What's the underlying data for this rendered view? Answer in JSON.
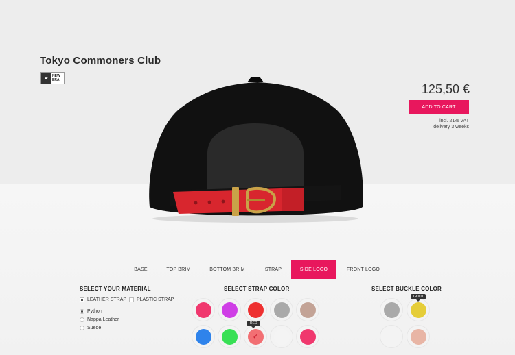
{
  "product": {
    "title": "Tokyo Commoners Club",
    "brand_logo_text": "NEW ERA",
    "price": "125,50 €",
    "add_to_cart": "ADD TO CART",
    "vat_line": "incl. 21% VAT",
    "delivery_line": "delivery 3 weeks"
  },
  "tabs": [
    {
      "label": "BASE",
      "active": false
    },
    {
      "label": "TOP BRIM",
      "active": false
    },
    {
      "label": "BOTTOM BRIM",
      "active": false
    },
    {
      "label": "STRAP",
      "active": false
    },
    {
      "label": "SIDE LOGO",
      "active": true
    },
    {
      "label": "FRONT LOGO",
      "active": false
    }
  ],
  "material": {
    "title": "SELECT YOUR MATERIAL",
    "types": [
      {
        "label": "LEATHER STRAP",
        "checked": true
      },
      {
        "label": "PLASTIC STRAP",
        "checked": false
      }
    ],
    "options": [
      {
        "label": "Python",
        "selected": true
      },
      {
        "label": "Nappa Leather",
        "selected": false
      },
      {
        "label": "Suede",
        "selected": false
      }
    ]
  },
  "strap_color": {
    "title": "SELECT STRAP COLOR",
    "tooltip": "RED",
    "selected": "red",
    "colors": [
      {
        "name": "pink",
        "hex": "#f0386e"
      },
      {
        "name": "magenta",
        "hex": "#cf3ee6"
      },
      {
        "name": "red",
        "hex": "#ee3030"
      },
      {
        "name": "grey",
        "hex": "#a9a9a9"
      },
      {
        "name": "taupe",
        "hex": "#c3a396"
      },
      {
        "name": "blue",
        "hex": "#2f83eb"
      },
      {
        "name": "green",
        "hex": "#38e055"
      },
      {
        "name": "light-red",
        "hex": "#f26f73"
      },
      {
        "name": "white",
        "hex": "#f4f4f4"
      },
      {
        "name": "pink",
        "hex": "#f0386e"
      }
    ]
  },
  "buckle_color": {
    "title": "SELECT BUCKLE COLOR",
    "tooltip": "GOLD",
    "colors": [
      {
        "name": "silver",
        "hex": "#a9a9a9"
      },
      {
        "name": "gold",
        "hex": "#e5cd38"
      },
      {
        "name": "white",
        "hex": "#f3f3f3"
      },
      {
        "name": "rose-gold",
        "hex": "#e8b5a5"
      }
    ]
  },
  "colors": {
    "accent": "#e8175d",
    "cap": "#0f0f0f",
    "strap": "#d8262e",
    "buckle": "#c9a248"
  }
}
